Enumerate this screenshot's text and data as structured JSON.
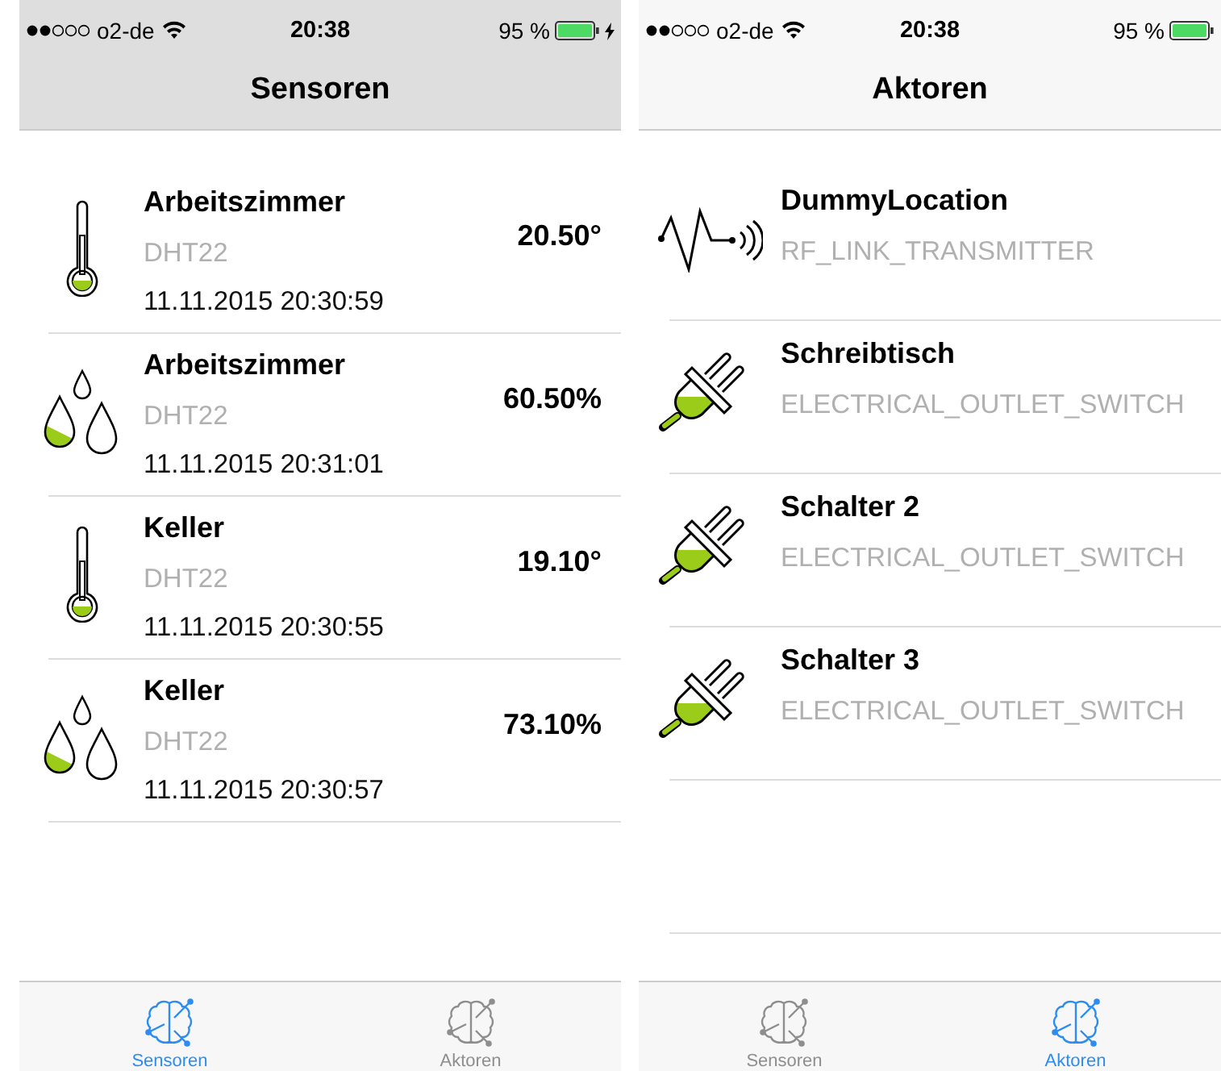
{
  "screens": [
    {
      "status_bar": {
        "carrier": "o2-de",
        "time": "20:38",
        "battery": "95 %",
        "charging": true
      },
      "title": "Sensoren",
      "color": "#dedede",
      "rows": [
        {
          "kind": "temperature",
          "name": "Arbeitszimmer",
          "type": "DHT22",
          "timestamp": "11.11.2015 20:30:59",
          "value": "20.50°"
        },
        {
          "kind": "humidity",
          "name": "Arbeitszimmer",
          "type": "DHT22",
          "timestamp": "11.11.2015 20:31:01",
          "value": "60.50%"
        },
        {
          "kind": "temperature",
          "name": "Keller",
          "type": "DHT22",
          "timestamp": "11.11.2015 20:30:55",
          "value": "19.10°"
        },
        {
          "kind": "humidity",
          "name": "Keller",
          "type": "DHT22",
          "timestamp": "11.11.2015 20:30:57",
          "value": "73.10%"
        }
      ],
      "tabs": [
        {
          "label": "Sensoren",
          "selected": true
        },
        {
          "label": "Aktoren",
          "selected": false
        }
      ]
    },
    {
      "status_bar": {
        "carrier": "o2-de",
        "time": "20:38",
        "battery": "95 %",
        "charging": false
      },
      "title": "Aktoren",
      "color": "#f7f7f7",
      "rows": [
        {
          "kind": "transmitter",
          "name": "DummyLocation",
          "type": "RF_LINK_TRANSMITTER"
        },
        {
          "kind": "outlet",
          "name": "Schreibtisch",
          "type": "ELECTRICAL_OUTLET_SWITCH"
        },
        {
          "kind": "outlet",
          "name": "Schalter 2",
          "type": "ELECTRICAL_OUTLET_SWITCH"
        },
        {
          "kind": "outlet",
          "name": "Schalter 3",
          "type": "ELECTRICAL_OUTLET_SWITCH"
        },
        {
          "kind": "empty"
        }
      ],
      "tabs": [
        {
          "label": "Sensoren",
          "selected": false
        },
        {
          "label": "Aktoren",
          "selected": true
        }
      ]
    }
  ]
}
